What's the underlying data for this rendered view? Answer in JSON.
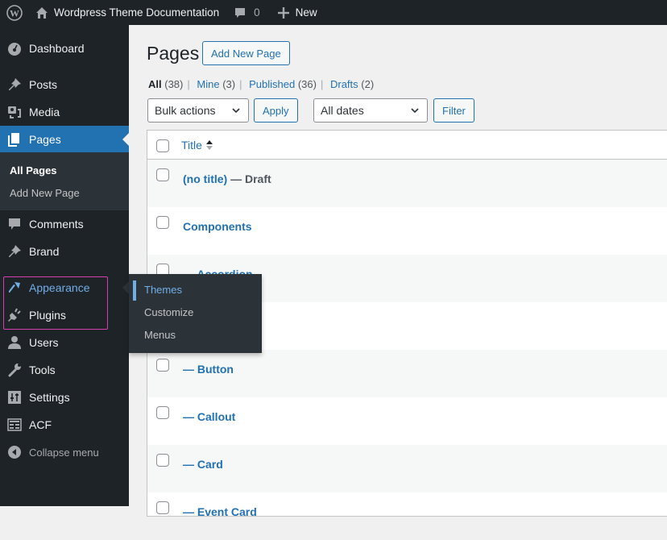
{
  "adminbar": {
    "site_name": "Wordpress Theme Documentation",
    "comments_count": "0",
    "new_label": "New"
  },
  "sidebar": {
    "items": [
      {
        "label": "Dashboard",
        "icon": "dashboard-icon"
      },
      {
        "label": "Posts",
        "icon": "pin-icon"
      },
      {
        "label": "Media",
        "icon": "media-icon"
      },
      {
        "label": "Pages",
        "icon": "pages-icon",
        "current": true
      },
      {
        "label": "Comments",
        "icon": "comment-icon"
      },
      {
        "label": "Brand",
        "icon": "pin-icon"
      },
      {
        "label": "Appearance",
        "icon": "paintbrush-icon",
        "hovered": true
      },
      {
        "label": "Plugins",
        "icon": "plugin-icon"
      },
      {
        "label": "Users",
        "icon": "user-icon"
      },
      {
        "label": "Tools",
        "icon": "wrench-icon"
      },
      {
        "label": "Settings",
        "icon": "settings-icon"
      },
      {
        "label": "ACF",
        "icon": "acf-icon"
      },
      {
        "label": "Collapse menu",
        "icon": "collapse-icon"
      }
    ],
    "pages_submenu": [
      {
        "label": "All Pages",
        "current": true
      },
      {
        "label": "Add New Page"
      }
    ]
  },
  "flyout": {
    "items": [
      {
        "label": "Themes",
        "current": true
      },
      {
        "label": "Customize"
      },
      {
        "label": "Menus"
      }
    ]
  },
  "main": {
    "title": "Pages",
    "add_new_label": "Add New Page",
    "filters": [
      {
        "label": "All",
        "count": "(38)",
        "current": true
      },
      {
        "label": "Mine",
        "count": "(3)"
      },
      {
        "label": "Published",
        "count": "(36)"
      },
      {
        "label": "Drafts",
        "count": "(2)"
      }
    ],
    "bulk_actions": "Bulk actions",
    "apply_label": "Apply",
    "dates_select": "All dates",
    "filter_label": "Filter",
    "table": {
      "column_title": "Title",
      "rows": [
        {
          "title": "(no title)",
          "state": " — Draft"
        },
        {
          "title": "Components",
          "state": ""
        },
        {
          "title": "— Accordion",
          "state": ""
        },
        {
          "title": "",
          "state": ""
        },
        {
          "title": "— Button",
          "state": ""
        },
        {
          "title": "— Callout",
          "state": ""
        },
        {
          "title": "— Card",
          "state": ""
        },
        {
          "title": "— Event Card",
          "state": ""
        }
      ]
    }
  },
  "colors": {
    "adminbar_bg": "#1d2327",
    "accent": "#2271b1",
    "hover_link": "#72aee6",
    "highlight_box": "#d63eaf"
  }
}
